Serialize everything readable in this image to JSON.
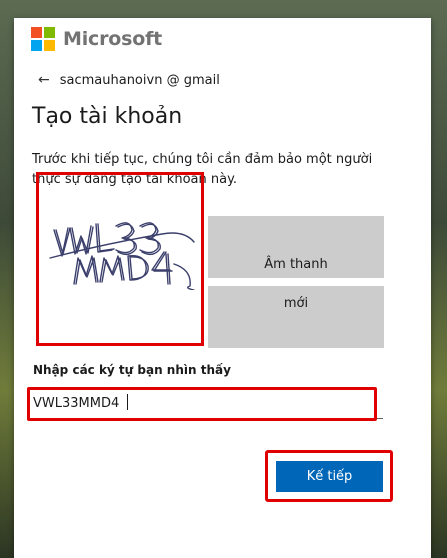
{
  "brand": {
    "name": "Microsoft",
    "logo_colors": [
      "#f25022",
      "#7fba00",
      "#00a4ef",
      "#ffb900"
    ]
  },
  "account": {
    "back_icon": "arrow-left-icon",
    "email": "sacmauhanoivn @ gmail"
  },
  "page": {
    "title": "Tạo tài khoản",
    "description": "Trước khi tiếp tục, chúng tôi cần đảm bảo một người thực sự đang tạo tài khoản này."
  },
  "captcha": {
    "image_text": "VWL33MMD4",
    "audio_label": "Âm thanh",
    "new_label": "mới",
    "input_label": "Nhập các ký tự bạn nhìn thấy",
    "input_value": "VWL33MMD4"
  },
  "actions": {
    "next_label": "Kế tiếp"
  },
  "colors": {
    "accent": "#0067b8",
    "highlight": "#e00000"
  }
}
